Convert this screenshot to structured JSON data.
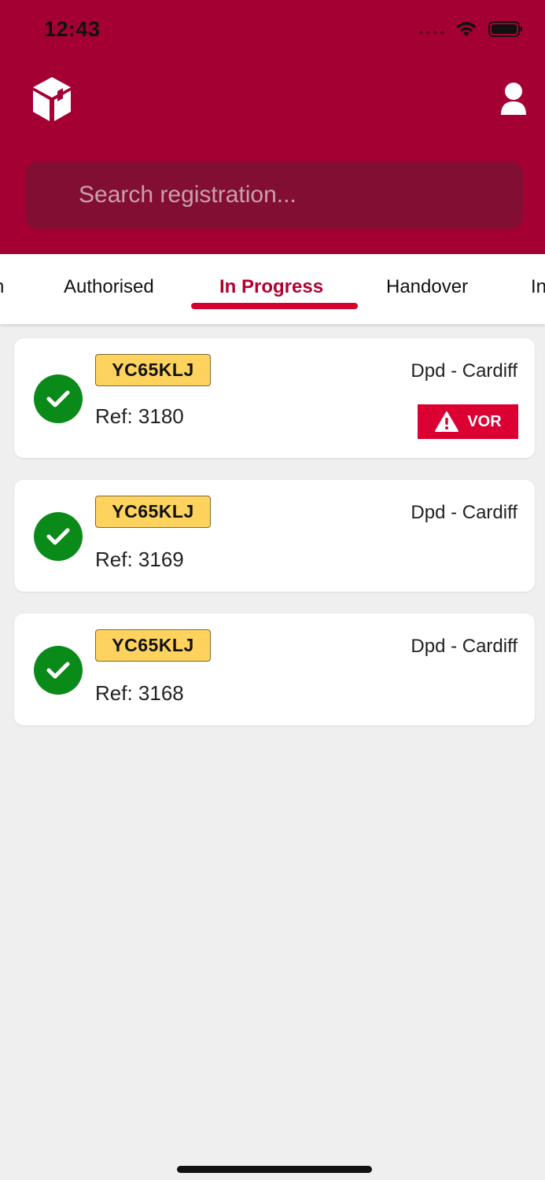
{
  "status_bar": {
    "time": "12:43"
  },
  "search": {
    "placeholder": "Search registration..."
  },
  "tabs": [
    {
      "label": "n",
      "active": false
    },
    {
      "label": "Authorised",
      "active": false
    },
    {
      "label": "In Progress",
      "active": true
    },
    {
      "label": "Handover",
      "active": false
    },
    {
      "label": "In",
      "active": false
    }
  ],
  "jobs": [
    {
      "registration": "YC65KLJ",
      "ref": "Ref: 3180",
      "location": "Dpd - Cardiff",
      "badge": "VOR"
    },
    {
      "registration": "YC65KLJ",
      "ref": "Ref: 3169",
      "location": "Dpd - Cardiff"
    },
    {
      "registration": "YC65KLJ",
      "ref": "Ref: 3168",
      "location": "Dpd - Cardiff"
    }
  ],
  "colors": {
    "header": "#a50034",
    "accent": "#d6002f",
    "plate": "#fdd35e",
    "status_ok": "#0a8a18",
    "vor_badge": "#dc0032"
  }
}
